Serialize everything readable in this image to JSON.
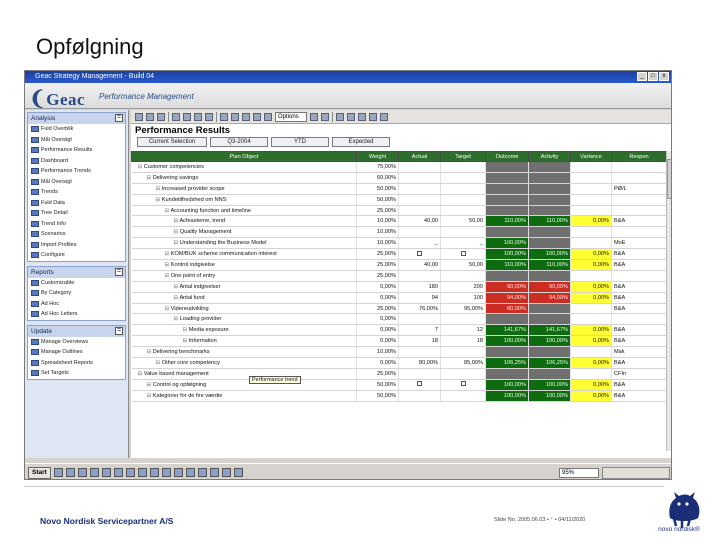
{
  "slide": {
    "title": "Opfølgning"
  },
  "app": {
    "window_title": "Geac Strategy Management - Build 04",
    "brand": "Geac",
    "brand_sub": "Performance Management",
    "window_buttons": [
      "_",
      "□",
      "x"
    ]
  },
  "sidebar": {
    "panels": [
      {
        "title": "Analysis",
        "toggle": "=",
        "items": [
          "Fuld Overblik",
          "Mål Oversigt",
          "Performance Results",
          "Dashboard",
          "Performance Trends",
          "Mål Oversigt",
          "Trends",
          "Fuld Data",
          "Tree Detail",
          "Trend Info",
          "Scenarios",
          "Import Profiles",
          "Configure"
        ]
      },
      {
        "title": "Reports",
        "toggle": "=",
        "items": [
          "Customizable",
          "By Category",
          "Ad Hoc",
          "Ad Hoc Letters"
        ]
      },
      {
        "title": "Update",
        "toggle": "=",
        "items": [
          "Manage Overviews",
          "Manage Outlines",
          "Spreadsheet Reports",
          "Set Targets"
        ]
      }
    ]
  },
  "toolbar": {
    "options_label": "Options",
    "zoom_label": ""
  },
  "main": {
    "heading": "Performance Results",
    "tabs": [
      "Current Selection",
      "Q3-2004",
      "YTD",
      "Expected"
    ]
  },
  "grid": {
    "columns": [
      "Plan Object",
      "Weight",
      "Actual",
      "Target",
      "Outcome",
      "Activity",
      "Variance",
      "Respon"
    ],
    "rows": [
      {
        "indent": 0,
        "name": "Customer competencies",
        "weight": "75,00%",
        "actual": "",
        "target": "",
        "outcome": "",
        "activity": "",
        "variance": "",
        "resp": "",
        "o": "grey",
        "a": "grey",
        "v": "none"
      },
      {
        "indent": 1,
        "name": "Delivering savings",
        "weight": "60,00%",
        "actual": "",
        "target": "",
        "outcome": "",
        "activity": "",
        "variance": "",
        "resp": "",
        "o": "grey",
        "a": "grey",
        "v": "none"
      },
      {
        "indent": 2,
        "name": "Increased provider scope",
        "weight": "50,00%",
        "actual": "",
        "target": "",
        "outcome": "",
        "activity": "",
        "variance": "",
        "resp": "PØ/L",
        "o": "grey",
        "a": "grey",
        "v": "none"
      },
      {
        "indent": 2,
        "name": "Kundetilfredshed om NNS",
        "weight": "50,00%",
        "actual": "",
        "target": "",
        "outcome": "",
        "activity": "",
        "variance": "",
        "resp": "",
        "o": "grey",
        "a": "grey",
        "v": "none"
      },
      {
        "indent": 3,
        "name": "Accounting function and timeline",
        "weight": "25,00%",
        "actual": "",
        "target": "",
        "outcome": "",
        "activity": "",
        "variance": "",
        "resp": "",
        "o": "grey",
        "a": "grey",
        "v": "none"
      },
      {
        "indent": 4,
        "name": "Acfeasterne, trend",
        "weight": "10,00%",
        "actual": "40,00",
        "target": "50,00",
        "outcome": "110,00%",
        "activity": "110,00%",
        "variance": "0,00%",
        "resp": "B&A",
        "o": "green",
        "a": "green",
        "v": "yellow"
      },
      {
        "indent": 4,
        "name": "Quality Management",
        "weight": "10,00%",
        "actual": "",
        "target": "",
        "outcome": "",
        "activity": "",
        "variance": "",
        "resp": "",
        "o": "grey",
        "a": "grey",
        "v": "none"
      },
      {
        "indent": 4,
        "name": "Understanding the Business Model",
        "weight": "10,00%",
        "actual": "_",
        "target": "_",
        "outcome": "100,00%",
        "activity": "",
        "variance": "",
        "resp": "MoE",
        "o": "green",
        "a": "grey",
        "v": "none"
      },
      {
        "indent": 3,
        "name": "KOM/BUK scheme communication interest",
        "weight": "25,00%",
        "actual": "chk",
        "target": "chk",
        "outcome": "100,00%",
        "activity": "100,00%",
        "variance": "0,00%",
        "resp": "B&A",
        "o": "green",
        "a": "green",
        "v": "yellow"
      },
      {
        "indent": 3,
        "name": "Kontrol indgivelse",
        "weight": "25,00%",
        "actual": "40,00",
        "target": "50,00",
        "outcome": "110,00%",
        "activity": "110,00%",
        "variance": "0,00%",
        "resp": "B&A",
        "o": "green",
        "a": "green",
        "v": "yellow"
      },
      {
        "indent": 3,
        "name": "One point of entry",
        "weight": "25,00%",
        "actual": "",
        "target": "",
        "outcome": "",
        "activity": "",
        "variance": "",
        "resp": "",
        "o": "grey",
        "a": "grey",
        "v": "none"
      },
      {
        "indent": 4,
        "name": "Antal indgivelser",
        "weight": "0,00%",
        "actual": "180",
        "target": "200",
        "outcome": "90,00%",
        "activity": "90,00%",
        "variance": "0,00%",
        "resp": "B&A",
        "o": "red",
        "a": "red",
        "v": "yellow"
      },
      {
        "indent": 4,
        "name": "Antal fund",
        "weight": "0,00%",
        "actual": "94",
        "target": "100",
        "outcome": "94,00%",
        "activity": "94,00%",
        "variance": "0,00%",
        "resp": "B&A",
        "o": "red",
        "a": "red",
        "v": "yellow"
      },
      {
        "indent": 3,
        "name": "Videreudvikling",
        "weight": "25,00%",
        "actual": "76,00%",
        "target": "95,00%",
        "outcome": "80,00%",
        "activity": "",
        "variance": "",
        "resp": "B&A",
        "o": "red",
        "a": "grey",
        "v": "none"
      },
      {
        "indent": 4,
        "name": "Loading provider",
        "weight": "0,00%",
        "actual": "",
        "target": "",
        "outcome": "",
        "activity": "",
        "variance": "",
        "resp": "",
        "o": "grey",
        "a": "grey",
        "v": "none"
      },
      {
        "indent": 5,
        "name": "Media exposure",
        "weight": "0,00%",
        "actual": "7",
        "target": "12",
        "outcome": "141,67%",
        "activity": "141,67%",
        "variance": "0,00%",
        "resp": "B&A",
        "o": "green",
        "a": "green",
        "v": "yellow"
      },
      {
        "indent": 5,
        "name": "Information",
        "weight": "0,00%",
        "actual": "18",
        "target": "18",
        "outcome": "100,00%",
        "activity": "100,00%",
        "variance": "0,00%",
        "resp": "B&A",
        "o": "green",
        "a": "green",
        "v": "yellow"
      },
      {
        "indent": 1,
        "name": "Delivering benchmarks",
        "weight": "10,00%",
        "actual": "",
        "target": "",
        "outcome": "",
        "activity": "",
        "variance": "",
        "resp": "Mak",
        "o": "grey",
        "a": "grey",
        "v": "none"
      },
      {
        "indent": 2,
        "name": "Other core competency",
        "weight": "0,00%",
        "actual": "80,00%",
        "target": "85,00%",
        "outcome": "106,25%",
        "activity": "106,25%",
        "variance": "0,00%",
        "resp": "B&A",
        "o": "green",
        "a": "green",
        "v": "yellow"
      },
      {
        "indent": 0,
        "name": "Value based management",
        "weight": "25,00%",
        "actual": "",
        "target": "",
        "outcome": "",
        "activity": "",
        "variance": "",
        "resp": "CFIn",
        "o": "grey",
        "a": "grey",
        "v": "none"
      },
      {
        "indent": 1,
        "name": "Control og opfølgning",
        "weight": "50,00%",
        "actual": "chk",
        "target": "chk",
        "outcome": "100,00%",
        "activity": "100,00%",
        "variance": "0,00%",
        "resp": "B&A",
        "o": "green",
        "a": "green",
        "v": "yellow"
      },
      {
        "indent": 1,
        "name": "Kategorier for de fire værdie",
        "weight": "50,00%",
        "actual": "",
        "target": "",
        "outcome": "100,00%",
        "activity": "100,00%",
        "variance": "0,00%",
        "resp": "B&A",
        "o": "green",
        "a": "green",
        "v": "yellow"
      }
    ],
    "tooltip": "Performance trend"
  },
  "taskbar": {
    "start": "Start",
    "zoom": "95%",
    "clock": ""
  },
  "footer": {
    "brand": "Novo Nordisk Servicepartner A/S",
    "info": "Slide No. 2005.06.03  •  ⁺  •  04/11/2020",
    "logo_text": "novo nordisk®"
  },
  "colors": {
    "outcome_good": "#0f6b0f",
    "outcome_bad": "#cc2d23",
    "variance": "#ffff33",
    "header_green": "#2d6e2d",
    "brand_blue": "#1b2e78"
  }
}
